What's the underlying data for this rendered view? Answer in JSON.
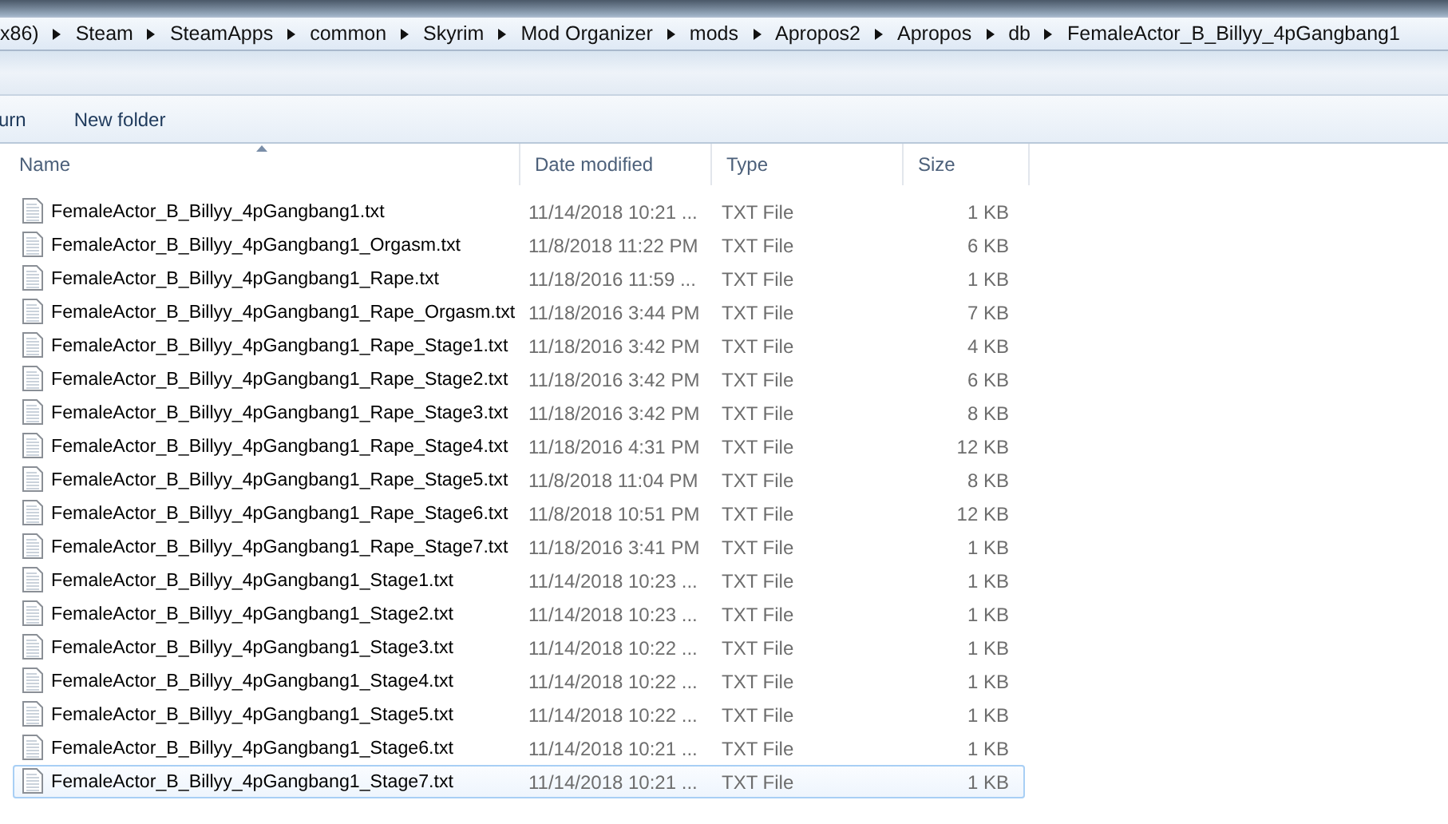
{
  "breadcrumbs": [
    "x86)",
    "Steam",
    "SteamApps",
    "common",
    "Skyrim",
    "Mod Organizer",
    "mods",
    "Apropos2",
    "Apropos",
    "db",
    "FemaleActor_B_Billyy_4pGangbang1"
  ],
  "toolbar": [
    "urn",
    "New folder"
  ],
  "columns": [
    {
      "label": "Name",
      "sorted": true
    },
    {
      "label": "Date modified",
      "sorted": false
    },
    {
      "label": "Type",
      "sorted": false
    },
    {
      "label": "Size",
      "sorted": false
    }
  ],
  "rows": [
    {
      "name": "FemaleActor_B_Billyy_4pGangbang1.txt",
      "date": "11/14/2018 10:21 ...",
      "type": "TXT File",
      "size": "1 KB",
      "selected": false
    },
    {
      "name": "FemaleActor_B_Billyy_4pGangbang1_Orgasm.txt",
      "date": "11/8/2018 11:22 PM",
      "type": "TXT File",
      "size": "6 KB",
      "selected": false
    },
    {
      "name": "FemaleActor_B_Billyy_4pGangbang1_Rape.txt",
      "date": "11/18/2016 11:59 ...",
      "type": "TXT File",
      "size": "1 KB",
      "selected": false
    },
    {
      "name": "FemaleActor_B_Billyy_4pGangbang1_Rape_Orgasm.txt",
      "date": "11/18/2016 3:44 PM",
      "type": "TXT File",
      "size": "7 KB",
      "selected": false
    },
    {
      "name": "FemaleActor_B_Billyy_4pGangbang1_Rape_Stage1.txt",
      "date": "11/18/2016 3:42 PM",
      "type": "TXT File",
      "size": "4 KB",
      "selected": false
    },
    {
      "name": "FemaleActor_B_Billyy_4pGangbang1_Rape_Stage2.txt",
      "date": "11/18/2016 3:42 PM",
      "type": "TXT File",
      "size": "6 KB",
      "selected": false
    },
    {
      "name": "FemaleActor_B_Billyy_4pGangbang1_Rape_Stage3.txt",
      "date": "11/18/2016 3:42 PM",
      "type": "TXT File",
      "size": "8 KB",
      "selected": false
    },
    {
      "name": "FemaleActor_B_Billyy_4pGangbang1_Rape_Stage4.txt",
      "date": "11/18/2016 4:31 PM",
      "type": "TXT File",
      "size": "12 KB",
      "selected": false
    },
    {
      "name": "FemaleActor_B_Billyy_4pGangbang1_Rape_Stage5.txt",
      "date": "11/8/2018 11:04 PM",
      "type": "TXT File",
      "size": "8 KB",
      "selected": false
    },
    {
      "name": "FemaleActor_B_Billyy_4pGangbang1_Rape_Stage6.txt",
      "date": "11/8/2018 10:51 PM",
      "type": "TXT File",
      "size": "12 KB",
      "selected": false
    },
    {
      "name": "FemaleActor_B_Billyy_4pGangbang1_Rape_Stage7.txt",
      "date": "11/18/2016 3:41 PM",
      "type": "TXT File",
      "size": "1 KB",
      "selected": false
    },
    {
      "name": "FemaleActor_B_Billyy_4pGangbang1_Stage1.txt",
      "date": "11/14/2018 10:23 ...",
      "type": "TXT File",
      "size": "1 KB",
      "selected": false
    },
    {
      "name": "FemaleActor_B_Billyy_4pGangbang1_Stage2.txt",
      "date": "11/14/2018 10:23 ...",
      "type": "TXT File",
      "size": "1 KB",
      "selected": false
    },
    {
      "name": "FemaleActor_B_Billyy_4pGangbang1_Stage3.txt",
      "date": "11/14/2018 10:22 ...",
      "type": "TXT File",
      "size": "1 KB",
      "selected": false
    },
    {
      "name": "FemaleActor_B_Billyy_4pGangbang1_Stage4.txt",
      "date": "11/14/2018 10:22 ...",
      "type": "TXT File",
      "size": "1 KB",
      "selected": false
    },
    {
      "name": "FemaleActor_B_Billyy_4pGangbang1_Stage5.txt",
      "date": "11/14/2018 10:22 ...",
      "type": "TXT File",
      "size": "1 KB",
      "selected": false
    },
    {
      "name": "FemaleActor_B_Billyy_4pGangbang1_Stage6.txt",
      "date": "11/14/2018 10:21 ...",
      "type": "TXT File",
      "size": "1 KB",
      "selected": false
    },
    {
      "name": "FemaleActor_B_Billyy_4pGangbang1_Stage7.txt",
      "date": "11/14/2018 10:21 ...",
      "type": "TXT File",
      "size": "1 KB",
      "selected": true
    }
  ]
}
